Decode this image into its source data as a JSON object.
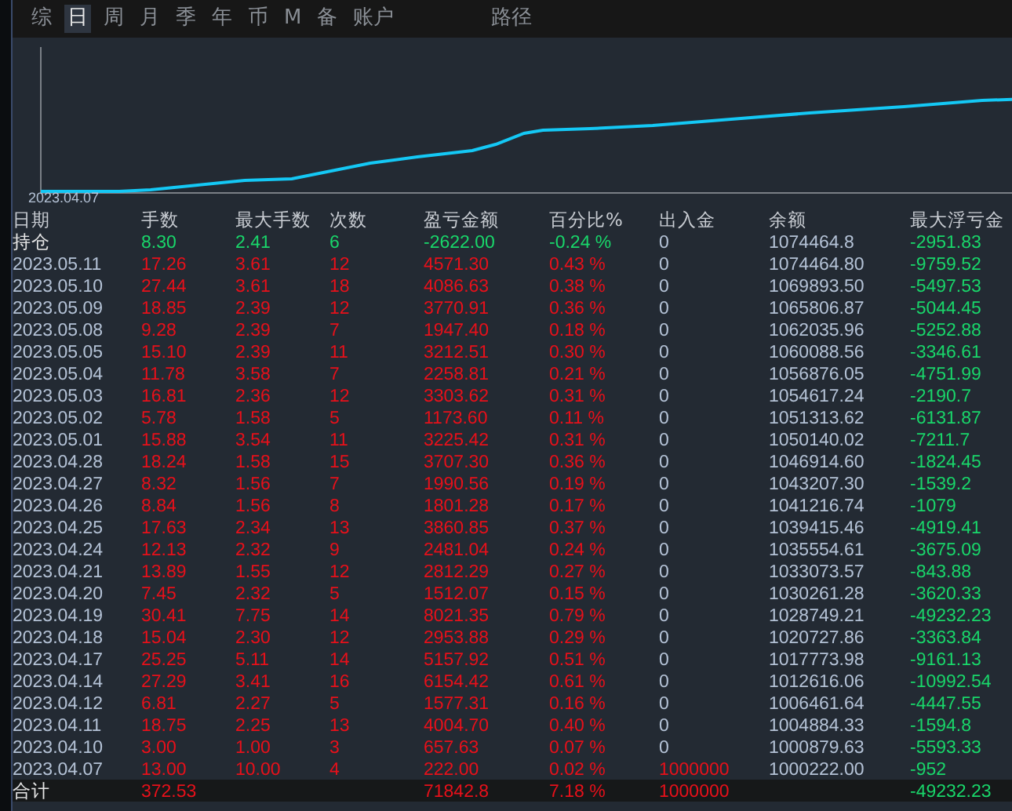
{
  "tabs": [
    {
      "label": "综",
      "selected": false
    },
    {
      "label": "日",
      "selected": true
    },
    {
      "label": "周",
      "selected": false
    },
    {
      "label": "月",
      "selected": false
    },
    {
      "label": "季",
      "selected": false
    },
    {
      "label": "年",
      "selected": false
    },
    {
      "label": "币",
      "selected": false
    },
    {
      "label": "M",
      "selected": false
    },
    {
      "label": "备",
      "selected": false
    },
    {
      "label": "账户",
      "selected": false
    },
    {
      "label": "路径",
      "selected": false
    }
  ],
  "chart": {
    "start_label": "2023.04.07"
  },
  "table": {
    "columns": [
      "日期",
      "手数",
      "最大手数",
      "次数",
      "盈亏金额",
      "百分比%",
      "出入金",
      "余额",
      "最大浮亏金"
    ],
    "rows": [
      {
        "kind": "holding",
        "cells": [
          {
            "text": "持仓",
            "color": "#e6e6e6"
          },
          {
            "text": "8.30",
            "color": "#19d66a"
          },
          {
            "text": "2.41",
            "color": "#19d66a"
          },
          {
            "text": "6",
            "color": "#19d66a"
          },
          {
            "text": "-2622.00",
            "color": "#19d66a"
          },
          {
            "text": "-0.24 %",
            "color": "#19d66a"
          },
          {
            "text": "0",
            "color": "#b4c2d6"
          },
          {
            "text": "1074464.8",
            "color": "#b4c2d6"
          },
          {
            "text": "-2951.83",
            "color": "#19d66a"
          }
        ]
      },
      {
        "kind": "day",
        "cells": [
          {
            "text": "2023.05.11",
            "color": "#b4c2d6"
          },
          {
            "text": "17.26",
            "color": "#e8101a"
          },
          {
            "text": "3.61",
            "color": "#e8101a"
          },
          {
            "text": "12",
            "color": "#e8101a"
          },
          {
            "text": "4571.30",
            "color": "#e8101a"
          },
          {
            "text": "0.43 %",
            "color": "#e8101a"
          },
          {
            "text": "0",
            "color": "#b4c2d6"
          },
          {
            "text": "1074464.80",
            "color": "#b4c2d6"
          },
          {
            "text": "-9759.52",
            "color": "#19d66a"
          }
        ]
      },
      {
        "kind": "day",
        "cells": [
          {
            "text": "2023.05.10",
            "color": "#b4c2d6"
          },
          {
            "text": "27.44",
            "color": "#e8101a"
          },
          {
            "text": "3.61",
            "color": "#e8101a"
          },
          {
            "text": "18",
            "color": "#e8101a"
          },
          {
            "text": "4086.63",
            "color": "#e8101a"
          },
          {
            "text": "0.38 %",
            "color": "#e8101a"
          },
          {
            "text": "0",
            "color": "#b4c2d6"
          },
          {
            "text": "1069893.50",
            "color": "#b4c2d6"
          },
          {
            "text": "-5497.53",
            "color": "#19d66a"
          }
        ]
      },
      {
        "kind": "day",
        "cells": [
          {
            "text": "2023.05.09",
            "color": "#b4c2d6"
          },
          {
            "text": "18.85",
            "color": "#e8101a"
          },
          {
            "text": "2.39",
            "color": "#e8101a"
          },
          {
            "text": "12",
            "color": "#e8101a"
          },
          {
            "text": "3770.91",
            "color": "#e8101a"
          },
          {
            "text": "0.36 %",
            "color": "#e8101a"
          },
          {
            "text": "0",
            "color": "#b4c2d6"
          },
          {
            "text": "1065806.87",
            "color": "#b4c2d6"
          },
          {
            "text": "-5044.45",
            "color": "#19d66a"
          }
        ]
      },
      {
        "kind": "day",
        "cells": [
          {
            "text": "2023.05.08",
            "color": "#b4c2d6"
          },
          {
            "text": "9.28",
            "color": "#e8101a"
          },
          {
            "text": "2.39",
            "color": "#e8101a"
          },
          {
            "text": "7",
            "color": "#e8101a"
          },
          {
            "text": "1947.40",
            "color": "#e8101a"
          },
          {
            "text": "0.18 %",
            "color": "#e8101a"
          },
          {
            "text": "0",
            "color": "#b4c2d6"
          },
          {
            "text": "1062035.96",
            "color": "#b4c2d6"
          },
          {
            "text": "-5252.88",
            "color": "#19d66a"
          }
        ]
      },
      {
        "kind": "day",
        "cells": [
          {
            "text": "2023.05.05",
            "color": "#b4c2d6"
          },
          {
            "text": "15.10",
            "color": "#e8101a"
          },
          {
            "text": "2.39",
            "color": "#e8101a"
          },
          {
            "text": "11",
            "color": "#e8101a"
          },
          {
            "text": "3212.51",
            "color": "#e8101a"
          },
          {
            "text": "0.30 %",
            "color": "#e8101a"
          },
          {
            "text": "0",
            "color": "#b4c2d6"
          },
          {
            "text": "1060088.56",
            "color": "#b4c2d6"
          },
          {
            "text": "-3346.61",
            "color": "#19d66a"
          }
        ]
      },
      {
        "kind": "day",
        "cells": [
          {
            "text": "2023.05.04",
            "color": "#b4c2d6"
          },
          {
            "text": "11.78",
            "color": "#e8101a"
          },
          {
            "text": "3.58",
            "color": "#e8101a"
          },
          {
            "text": "7",
            "color": "#e8101a"
          },
          {
            "text": "2258.81",
            "color": "#e8101a"
          },
          {
            "text": "0.21 %",
            "color": "#e8101a"
          },
          {
            "text": "0",
            "color": "#b4c2d6"
          },
          {
            "text": "1056876.05",
            "color": "#b4c2d6"
          },
          {
            "text": "-4751.99",
            "color": "#19d66a"
          }
        ]
      },
      {
        "kind": "day",
        "cells": [
          {
            "text": "2023.05.03",
            "color": "#b4c2d6"
          },
          {
            "text": "16.81",
            "color": "#e8101a"
          },
          {
            "text": "2.36",
            "color": "#e8101a"
          },
          {
            "text": "12",
            "color": "#e8101a"
          },
          {
            "text": "3303.62",
            "color": "#e8101a"
          },
          {
            "text": "0.31 %",
            "color": "#e8101a"
          },
          {
            "text": "0",
            "color": "#b4c2d6"
          },
          {
            "text": "1054617.24",
            "color": "#b4c2d6"
          },
          {
            "text": "-2190.7",
            "color": "#19d66a"
          }
        ]
      },
      {
        "kind": "day",
        "cells": [
          {
            "text": "2023.05.02",
            "color": "#b4c2d6"
          },
          {
            "text": "5.78",
            "color": "#e8101a"
          },
          {
            "text": "1.58",
            "color": "#e8101a"
          },
          {
            "text": "5",
            "color": "#e8101a"
          },
          {
            "text": "1173.60",
            "color": "#e8101a"
          },
          {
            "text": "0.11 %",
            "color": "#e8101a"
          },
          {
            "text": "0",
            "color": "#b4c2d6"
          },
          {
            "text": "1051313.62",
            "color": "#b4c2d6"
          },
          {
            "text": "-6131.87",
            "color": "#19d66a"
          }
        ]
      },
      {
        "kind": "day",
        "cells": [
          {
            "text": "2023.05.01",
            "color": "#b4c2d6"
          },
          {
            "text": "15.88",
            "color": "#e8101a"
          },
          {
            "text": "3.54",
            "color": "#e8101a"
          },
          {
            "text": "11",
            "color": "#e8101a"
          },
          {
            "text": "3225.42",
            "color": "#e8101a"
          },
          {
            "text": "0.31 %",
            "color": "#e8101a"
          },
          {
            "text": "0",
            "color": "#b4c2d6"
          },
          {
            "text": "1050140.02",
            "color": "#b4c2d6"
          },
          {
            "text": "-7211.7",
            "color": "#19d66a"
          }
        ]
      },
      {
        "kind": "day",
        "cells": [
          {
            "text": "2023.04.28",
            "color": "#b4c2d6"
          },
          {
            "text": "18.24",
            "color": "#e8101a"
          },
          {
            "text": "1.58",
            "color": "#e8101a"
          },
          {
            "text": "15",
            "color": "#e8101a"
          },
          {
            "text": "3707.30",
            "color": "#e8101a"
          },
          {
            "text": "0.36 %",
            "color": "#e8101a"
          },
          {
            "text": "0",
            "color": "#b4c2d6"
          },
          {
            "text": "1046914.60",
            "color": "#b4c2d6"
          },
          {
            "text": "-1824.45",
            "color": "#19d66a"
          }
        ]
      },
      {
        "kind": "day",
        "cells": [
          {
            "text": "2023.04.27",
            "color": "#b4c2d6"
          },
          {
            "text": "8.32",
            "color": "#e8101a"
          },
          {
            "text": "1.56",
            "color": "#e8101a"
          },
          {
            "text": "7",
            "color": "#e8101a"
          },
          {
            "text": "1990.56",
            "color": "#e8101a"
          },
          {
            "text": "0.19 %",
            "color": "#e8101a"
          },
          {
            "text": "0",
            "color": "#b4c2d6"
          },
          {
            "text": "1043207.30",
            "color": "#b4c2d6"
          },
          {
            "text": "-1539.2",
            "color": "#19d66a"
          }
        ]
      },
      {
        "kind": "day",
        "cells": [
          {
            "text": "2023.04.26",
            "color": "#b4c2d6"
          },
          {
            "text": "8.84",
            "color": "#e8101a"
          },
          {
            "text": "1.56",
            "color": "#e8101a"
          },
          {
            "text": "8",
            "color": "#e8101a"
          },
          {
            "text": "1801.28",
            "color": "#e8101a"
          },
          {
            "text": "0.17 %",
            "color": "#e8101a"
          },
          {
            "text": "0",
            "color": "#b4c2d6"
          },
          {
            "text": "1041216.74",
            "color": "#b4c2d6"
          },
          {
            "text": "-1079",
            "color": "#19d66a"
          }
        ]
      },
      {
        "kind": "day",
        "cells": [
          {
            "text": "2023.04.25",
            "color": "#b4c2d6"
          },
          {
            "text": "17.63",
            "color": "#e8101a"
          },
          {
            "text": "2.34",
            "color": "#e8101a"
          },
          {
            "text": "13",
            "color": "#e8101a"
          },
          {
            "text": "3860.85",
            "color": "#e8101a"
          },
          {
            "text": "0.37 %",
            "color": "#e8101a"
          },
          {
            "text": "0",
            "color": "#b4c2d6"
          },
          {
            "text": "1039415.46",
            "color": "#b4c2d6"
          },
          {
            "text": "-4919.41",
            "color": "#19d66a"
          }
        ]
      },
      {
        "kind": "day",
        "cells": [
          {
            "text": "2023.04.24",
            "color": "#b4c2d6"
          },
          {
            "text": "12.13",
            "color": "#e8101a"
          },
          {
            "text": "2.32",
            "color": "#e8101a"
          },
          {
            "text": "9",
            "color": "#e8101a"
          },
          {
            "text": "2481.04",
            "color": "#e8101a"
          },
          {
            "text": "0.24 %",
            "color": "#e8101a"
          },
          {
            "text": "0",
            "color": "#b4c2d6"
          },
          {
            "text": "1035554.61",
            "color": "#b4c2d6"
          },
          {
            "text": "-3675.09",
            "color": "#19d66a"
          }
        ]
      },
      {
        "kind": "day",
        "cells": [
          {
            "text": "2023.04.21",
            "color": "#b4c2d6"
          },
          {
            "text": "13.89",
            "color": "#e8101a"
          },
          {
            "text": "1.55",
            "color": "#e8101a"
          },
          {
            "text": "12",
            "color": "#e8101a"
          },
          {
            "text": "2812.29",
            "color": "#e8101a"
          },
          {
            "text": "0.27 %",
            "color": "#e8101a"
          },
          {
            "text": "0",
            "color": "#b4c2d6"
          },
          {
            "text": "1033073.57",
            "color": "#b4c2d6"
          },
          {
            "text": "-843.88",
            "color": "#19d66a"
          }
        ]
      },
      {
        "kind": "day",
        "cells": [
          {
            "text": "2023.04.20",
            "color": "#b4c2d6"
          },
          {
            "text": "7.45",
            "color": "#e8101a"
          },
          {
            "text": "2.32",
            "color": "#e8101a"
          },
          {
            "text": "5",
            "color": "#e8101a"
          },
          {
            "text": "1512.07",
            "color": "#e8101a"
          },
          {
            "text": "0.15 %",
            "color": "#e8101a"
          },
          {
            "text": "0",
            "color": "#b4c2d6"
          },
          {
            "text": "1030261.28",
            "color": "#b4c2d6"
          },
          {
            "text": "-3620.33",
            "color": "#19d66a"
          }
        ]
      },
      {
        "kind": "day",
        "cells": [
          {
            "text": "2023.04.19",
            "color": "#b4c2d6"
          },
          {
            "text": "30.41",
            "color": "#e8101a"
          },
          {
            "text": "7.75",
            "color": "#e8101a"
          },
          {
            "text": "14",
            "color": "#e8101a"
          },
          {
            "text": "8021.35",
            "color": "#e8101a"
          },
          {
            "text": "0.79 %",
            "color": "#e8101a"
          },
          {
            "text": "0",
            "color": "#b4c2d6"
          },
          {
            "text": "1028749.21",
            "color": "#b4c2d6"
          },
          {
            "text": "-49232.23",
            "color": "#19d66a"
          }
        ]
      },
      {
        "kind": "day",
        "cells": [
          {
            "text": "2023.04.18",
            "color": "#b4c2d6"
          },
          {
            "text": "15.04",
            "color": "#e8101a"
          },
          {
            "text": "2.30",
            "color": "#e8101a"
          },
          {
            "text": "12",
            "color": "#e8101a"
          },
          {
            "text": "2953.88",
            "color": "#e8101a"
          },
          {
            "text": "0.29 %",
            "color": "#e8101a"
          },
          {
            "text": "0",
            "color": "#b4c2d6"
          },
          {
            "text": "1020727.86",
            "color": "#b4c2d6"
          },
          {
            "text": "-3363.84",
            "color": "#19d66a"
          }
        ]
      },
      {
        "kind": "day",
        "cells": [
          {
            "text": "2023.04.17",
            "color": "#b4c2d6"
          },
          {
            "text": "25.25",
            "color": "#e8101a"
          },
          {
            "text": "5.11",
            "color": "#e8101a"
          },
          {
            "text": "14",
            "color": "#e8101a"
          },
          {
            "text": "5157.92",
            "color": "#e8101a"
          },
          {
            "text": "0.51 %",
            "color": "#e8101a"
          },
          {
            "text": "0",
            "color": "#b4c2d6"
          },
          {
            "text": "1017773.98",
            "color": "#b4c2d6"
          },
          {
            "text": "-9161.13",
            "color": "#19d66a"
          }
        ]
      },
      {
        "kind": "day",
        "cells": [
          {
            "text": "2023.04.14",
            "color": "#b4c2d6"
          },
          {
            "text": "27.29",
            "color": "#e8101a"
          },
          {
            "text": "3.41",
            "color": "#e8101a"
          },
          {
            "text": "16",
            "color": "#e8101a"
          },
          {
            "text": "6154.42",
            "color": "#e8101a"
          },
          {
            "text": "0.61 %",
            "color": "#e8101a"
          },
          {
            "text": "0",
            "color": "#b4c2d6"
          },
          {
            "text": "1012616.06",
            "color": "#b4c2d6"
          },
          {
            "text": "-10992.54",
            "color": "#19d66a"
          }
        ]
      },
      {
        "kind": "day",
        "cells": [
          {
            "text": "2023.04.12",
            "color": "#b4c2d6"
          },
          {
            "text": "6.81",
            "color": "#e8101a"
          },
          {
            "text": "2.27",
            "color": "#e8101a"
          },
          {
            "text": "5",
            "color": "#e8101a"
          },
          {
            "text": "1577.31",
            "color": "#e8101a"
          },
          {
            "text": "0.16 %",
            "color": "#e8101a"
          },
          {
            "text": "0",
            "color": "#b4c2d6"
          },
          {
            "text": "1006461.64",
            "color": "#b4c2d6"
          },
          {
            "text": "-4447.55",
            "color": "#19d66a"
          }
        ]
      },
      {
        "kind": "day",
        "cells": [
          {
            "text": "2023.04.11",
            "color": "#b4c2d6"
          },
          {
            "text": "18.75",
            "color": "#e8101a"
          },
          {
            "text": "2.25",
            "color": "#e8101a"
          },
          {
            "text": "13",
            "color": "#e8101a"
          },
          {
            "text": "4004.70",
            "color": "#e8101a"
          },
          {
            "text": "0.40 %",
            "color": "#e8101a"
          },
          {
            "text": "0",
            "color": "#b4c2d6"
          },
          {
            "text": "1004884.33",
            "color": "#b4c2d6"
          },
          {
            "text": "-1594.8",
            "color": "#19d66a"
          }
        ]
      },
      {
        "kind": "day",
        "cells": [
          {
            "text": "2023.04.10",
            "color": "#b4c2d6"
          },
          {
            "text": "3.00",
            "color": "#e8101a"
          },
          {
            "text": "1.00",
            "color": "#e8101a"
          },
          {
            "text": "3",
            "color": "#e8101a"
          },
          {
            "text": "657.63",
            "color": "#e8101a"
          },
          {
            "text": "0.07 %",
            "color": "#e8101a"
          },
          {
            "text": "0",
            "color": "#b4c2d6"
          },
          {
            "text": "1000879.63",
            "color": "#b4c2d6"
          },
          {
            "text": "-5593.33",
            "color": "#19d66a"
          }
        ]
      },
      {
        "kind": "day",
        "cells": [
          {
            "text": "2023.04.07",
            "color": "#b4c2d6"
          },
          {
            "text": "13.00",
            "color": "#e8101a"
          },
          {
            "text": "10.00",
            "color": "#e8101a"
          },
          {
            "text": "4",
            "color": "#e8101a"
          },
          {
            "text": "222.00",
            "color": "#e8101a"
          },
          {
            "text": "0.02 %",
            "color": "#e8101a"
          },
          {
            "text": "1000000",
            "color": "#e8101a"
          },
          {
            "text": "1000222.00",
            "color": "#b4c2d6"
          },
          {
            "text": "-952",
            "color": "#19d66a"
          }
        ]
      },
      {
        "kind": "total",
        "cells": [
          {
            "text": "合计",
            "color": "#e6e6e6"
          },
          {
            "text": "372.53",
            "color": "#e8101a"
          },
          null,
          null,
          {
            "text": "71842.8",
            "color": "#e8101a"
          },
          {
            "text": "7.18 %",
            "color": "#e8101a"
          },
          {
            "text": "1000000",
            "color": "#e8101a"
          },
          null,
          {
            "text": "-49232.23",
            "color": "#19d66a"
          }
        ]
      }
    ]
  }
}
